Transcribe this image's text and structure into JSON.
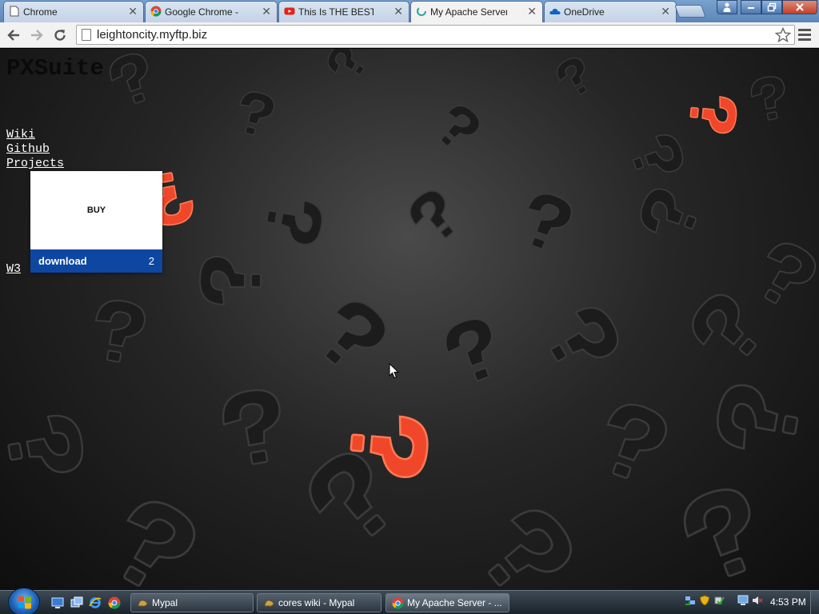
{
  "browser": {
    "tabs": [
      {
        "label": "Chrome",
        "icon": "document-icon",
        "active": false
      },
      {
        "label": "Google Chrome - Do",
        "icon": "chrome-icon",
        "active": false
      },
      {
        "label": "This Is THE BEST SEA",
        "icon": "youtube-icon",
        "active": false
      },
      {
        "label": "My Apache Server",
        "icon": "loading-icon",
        "active": true
      },
      {
        "label": "OneDrive",
        "icon": "onedrive-icon",
        "active": false
      }
    ],
    "tab_close_glyph": "✕",
    "url": "leightoncity.myftp.biz",
    "colors": {
      "titlebar": "#5d86b8",
      "active_tab": "#f2f2f2"
    }
  },
  "page": {
    "title": "PXSuite",
    "subtitle": "PXSuite",
    "links": [
      "Wiki",
      "Github",
      "Projects",
      "W3"
    ],
    "card": {
      "buy_label": "BUY",
      "download_label": "download",
      "download_count": "2",
      "download_bar_color": "#0d47a1"
    }
  },
  "taskbar": {
    "tasks": [
      {
        "label": "Mypal",
        "icon": "mypal-icon",
        "active": false
      },
      {
        "label": "cores wiki - Mypal",
        "icon": "mypal-icon",
        "active": false
      },
      {
        "label": "My Apache Server - ...",
        "icon": "chrome-icon",
        "active": true
      }
    ],
    "clock": "4:53 PM"
  }
}
